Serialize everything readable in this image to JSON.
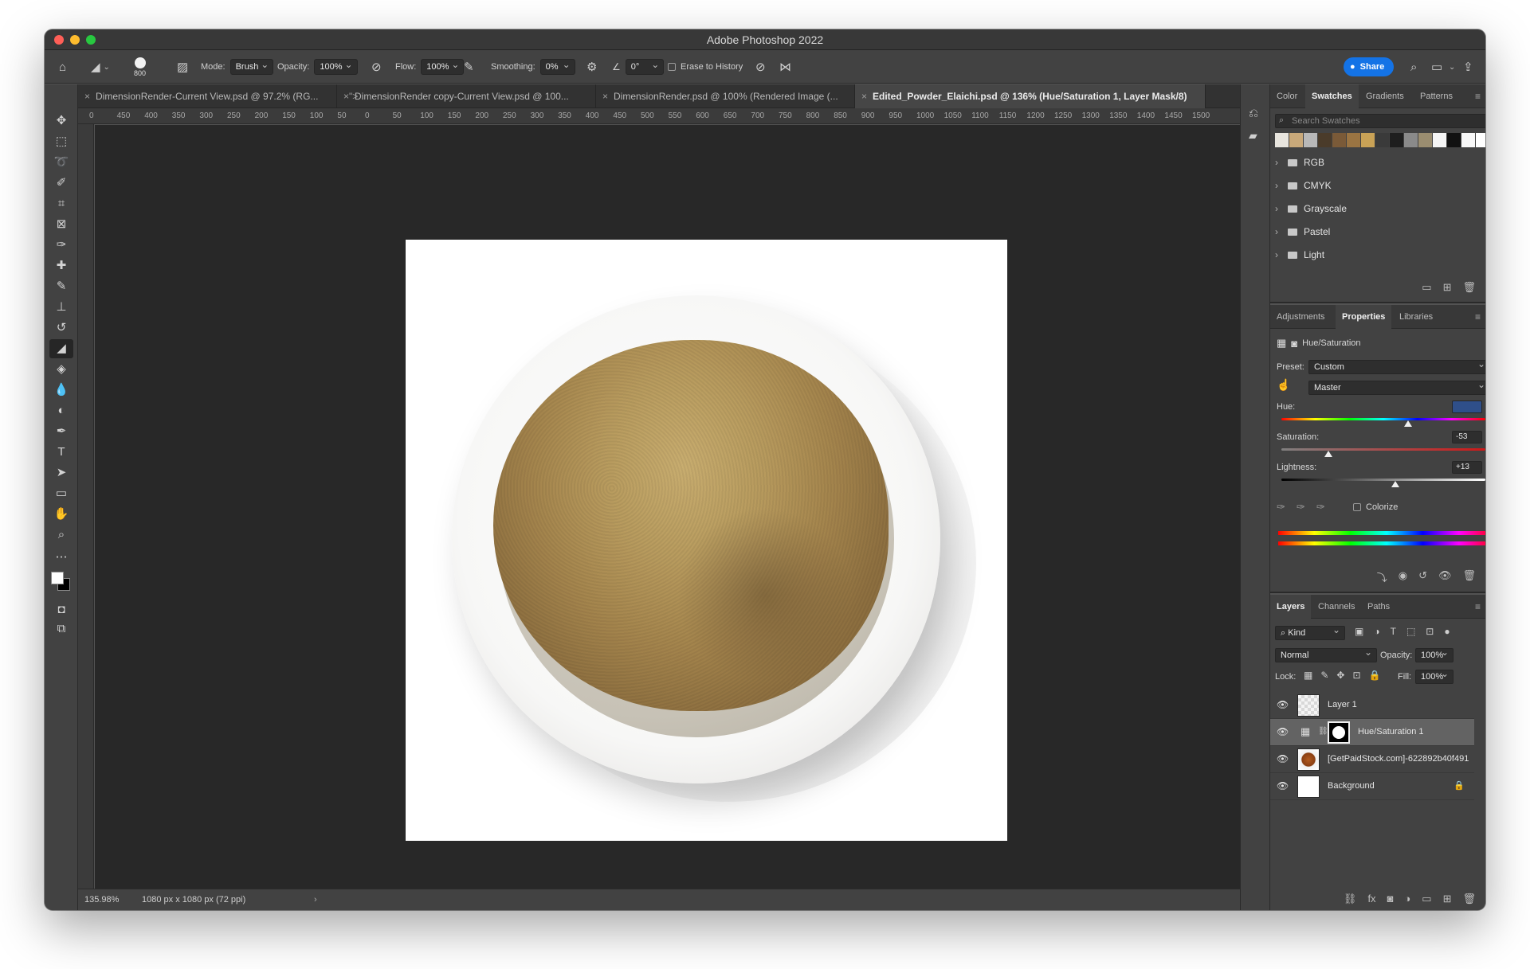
{
  "app": {
    "title": "Adobe Photoshop 2022"
  },
  "options_bar": {
    "brush_size": "800",
    "mode_label": "Mode:",
    "mode_value": "Brush",
    "opacity_label": "Opacity:",
    "opacity_value": "100%",
    "flow_label": "Flow:",
    "flow_value": "100%",
    "smoothing_label": "Smoothing:",
    "smoothing_value": "0%",
    "angle_value": "0°",
    "erase_history_label": "Erase to History",
    "share_label": "Share"
  },
  "doc_tabs": [
    {
      "label": "DimensionRender-Current View.psd @ 97.2% (RG...",
      "active": false
    },
    {
      "label": "DimensionRender copy-Current View.psd @ 100...",
      "active": false
    },
    {
      "label": "DimensionRender.psd @ 100% (Rendered Image (...",
      "active": false
    },
    {
      "label": "Edited_Powder_Elaichi.psd @ 136% (Hue/Saturation 1, Layer Mask/8)",
      "active": true
    }
  ],
  "ruler": {
    "top_ticks": [
      "0",
      "450",
      "400",
      "350",
      "300",
      "250",
      "200",
      "150",
      "100",
      "50",
      "0",
      "50",
      "100",
      "150",
      "200",
      "250",
      "300",
      "350",
      "400",
      "450",
      "500",
      "550",
      "600",
      "650",
      "700",
      "750",
      "800",
      "850",
      "900",
      "950",
      "1000",
      "1050",
      "1100",
      "1150",
      "1200",
      "1250",
      "1300",
      "1350",
      "1400",
      "1450",
      "1500"
    ]
  },
  "status": {
    "zoom": "135.98%",
    "doc_info": "1080 px x 1080 px (72 ppi)"
  },
  "swatches_panel": {
    "tabs": [
      "Color",
      "Swatches",
      "Gradients",
      "Patterns"
    ],
    "active_tab": "Swatches",
    "search_placeholder": "Search Swatches",
    "recent_colors": [
      "#e8e5de",
      "#c9a97a",
      "#b8b8b8",
      "#4a3b2a",
      "#7a5a38",
      "#9a7442",
      "#c9a256",
      "#3a3a3a",
      "#1e1e1e",
      "#8a8a8a",
      "#9a8d70",
      "#f5f5f5",
      "#111111",
      "#f8f8f8",
      "#ffffff",
      "#000000"
    ],
    "groups": [
      "RGB",
      "CMYK",
      "Grayscale",
      "Pastel",
      "Light"
    ]
  },
  "properties_panel": {
    "tabs": [
      "Adjustments",
      "Properties",
      "Libraries"
    ],
    "active_tab": "Properties",
    "adjustment_name": "Hue/Saturation",
    "preset_label": "Preset:",
    "preset_value": "Custom",
    "channel_value": "Master",
    "hue_label": "Hue:",
    "hue_value": "",
    "hue_position": 0.62,
    "saturation_label": "Saturation:",
    "saturation_value": "-53",
    "saturation_position": 0.23,
    "lightness_label": "Lightness:",
    "lightness_value": "+13",
    "lightness_position": 0.56,
    "colorize_label": "Colorize"
  },
  "layers_panel": {
    "tabs": [
      "Layers",
      "Channels",
      "Paths"
    ],
    "active_tab": "Layers",
    "filter_label": "Kind",
    "blend_mode": "Normal",
    "opacity_label": "Opacity:",
    "opacity_value": "100%",
    "lock_label": "Lock:",
    "fill_label": "Fill:",
    "fill_value": "100%",
    "layers": [
      {
        "name": "Layer 1",
        "type": "transparent",
        "active": false
      },
      {
        "name": "Hue/Saturation 1",
        "type": "adjustment",
        "active": true
      },
      {
        "name": "[GetPaidStock.com]-622892b40f491",
        "type": "smart",
        "active": false
      },
      {
        "name": "Background",
        "type": "background",
        "active": false
      }
    ]
  },
  "colors": {
    "accent": "#1473e6",
    "foreground": "#ffffff",
    "background": "#000000"
  }
}
